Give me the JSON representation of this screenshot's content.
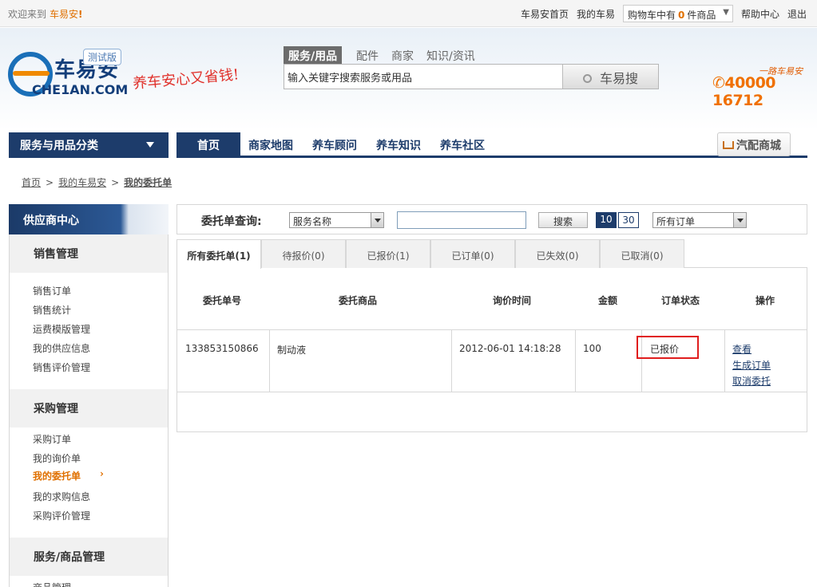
{
  "topbar": {
    "welcome": "欢迎来到",
    "brand": "车易安",
    "bang": "!",
    "links": [
      "车易安首页",
      "我的车易"
    ],
    "cart_prefix": "购物车中有",
    "cart_count": "0",
    "cart_suffix": "件商品",
    "help": "帮助中心",
    "logout": "退出"
  },
  "header": {
    "logo_cn": "车易安",
    "logo_en": "CHE1AN.COM",
    "beta": "测试版",
    "slogan": "养车安心又省钱!",
    "search_tabs": [
      "服务/用品",
      "配件",
      "商家",
      "知识/资讯"
    ],
    "search_value": "输入关键字搜索服务或用品",
    "search_button": "车易搜",
    "hotline_label": "一路车易安",
    "hotline": "40000 16712"
  },
  "nav": {
    "category": "服务与用品分类",
    "items": [
      "首页",
      "商家地图",
      "养车顾问",
      "养车知识",
      "养车社区"
    ],
    "mall": "汽配商城"
  },
  "breadcrumb": {
    "home": "首页",
    "mine": "我的车易安",
    "current": "我的委托单"
  },
  "sidebar": {
    "header": "供应商中心",
    "sections": [
      {
        "title": "销售管理",
        "items": [
          "销售订单",
          "销售统计",
          "运费模版管理",
          "我的供应信息",
          "销售评价管理"
        ]
      },
      {
        "title": "采购管理",
        "items": [
          "采购订单",
          "我的询价单",
          "我的委托单",
          "我的求购信息",
          "采购评价管理"
        ]
      },
      {
        "title": "服务/商品管理",
        "items": [
          "商品管理"
        ]
      }
    ]
  },
  "query": {
    "label": "委托单查询:",
    "field_select": "服务名称",
    "search_button": "搜索",
    "page_sizes": [
      "10",
      "30"
    ],
    "order_select": "所有订单"
  },
  "tabs": [
    "所有委托单(1)",
    "待报价(0)",
    "已报价(1)",
    "已订单(0)",
    "已失效(0)",
    "已取消(0)"
  ],
  "table": {
    "headers": [
      "委托单号",
      "委托商品",
      "询价时间",
      "金额",
      "订单状态",
      "操作"
    ],
    "row": {
      "id": "133853150866",
      "product": "制动液",
      "time": "2012-06-01 14:18:28",
      "amount": "100",
      "status": "已报价",
      "actions": [
        "查看",
        "生成订单",
        "取消委托"
      ]
    }
  }
}
